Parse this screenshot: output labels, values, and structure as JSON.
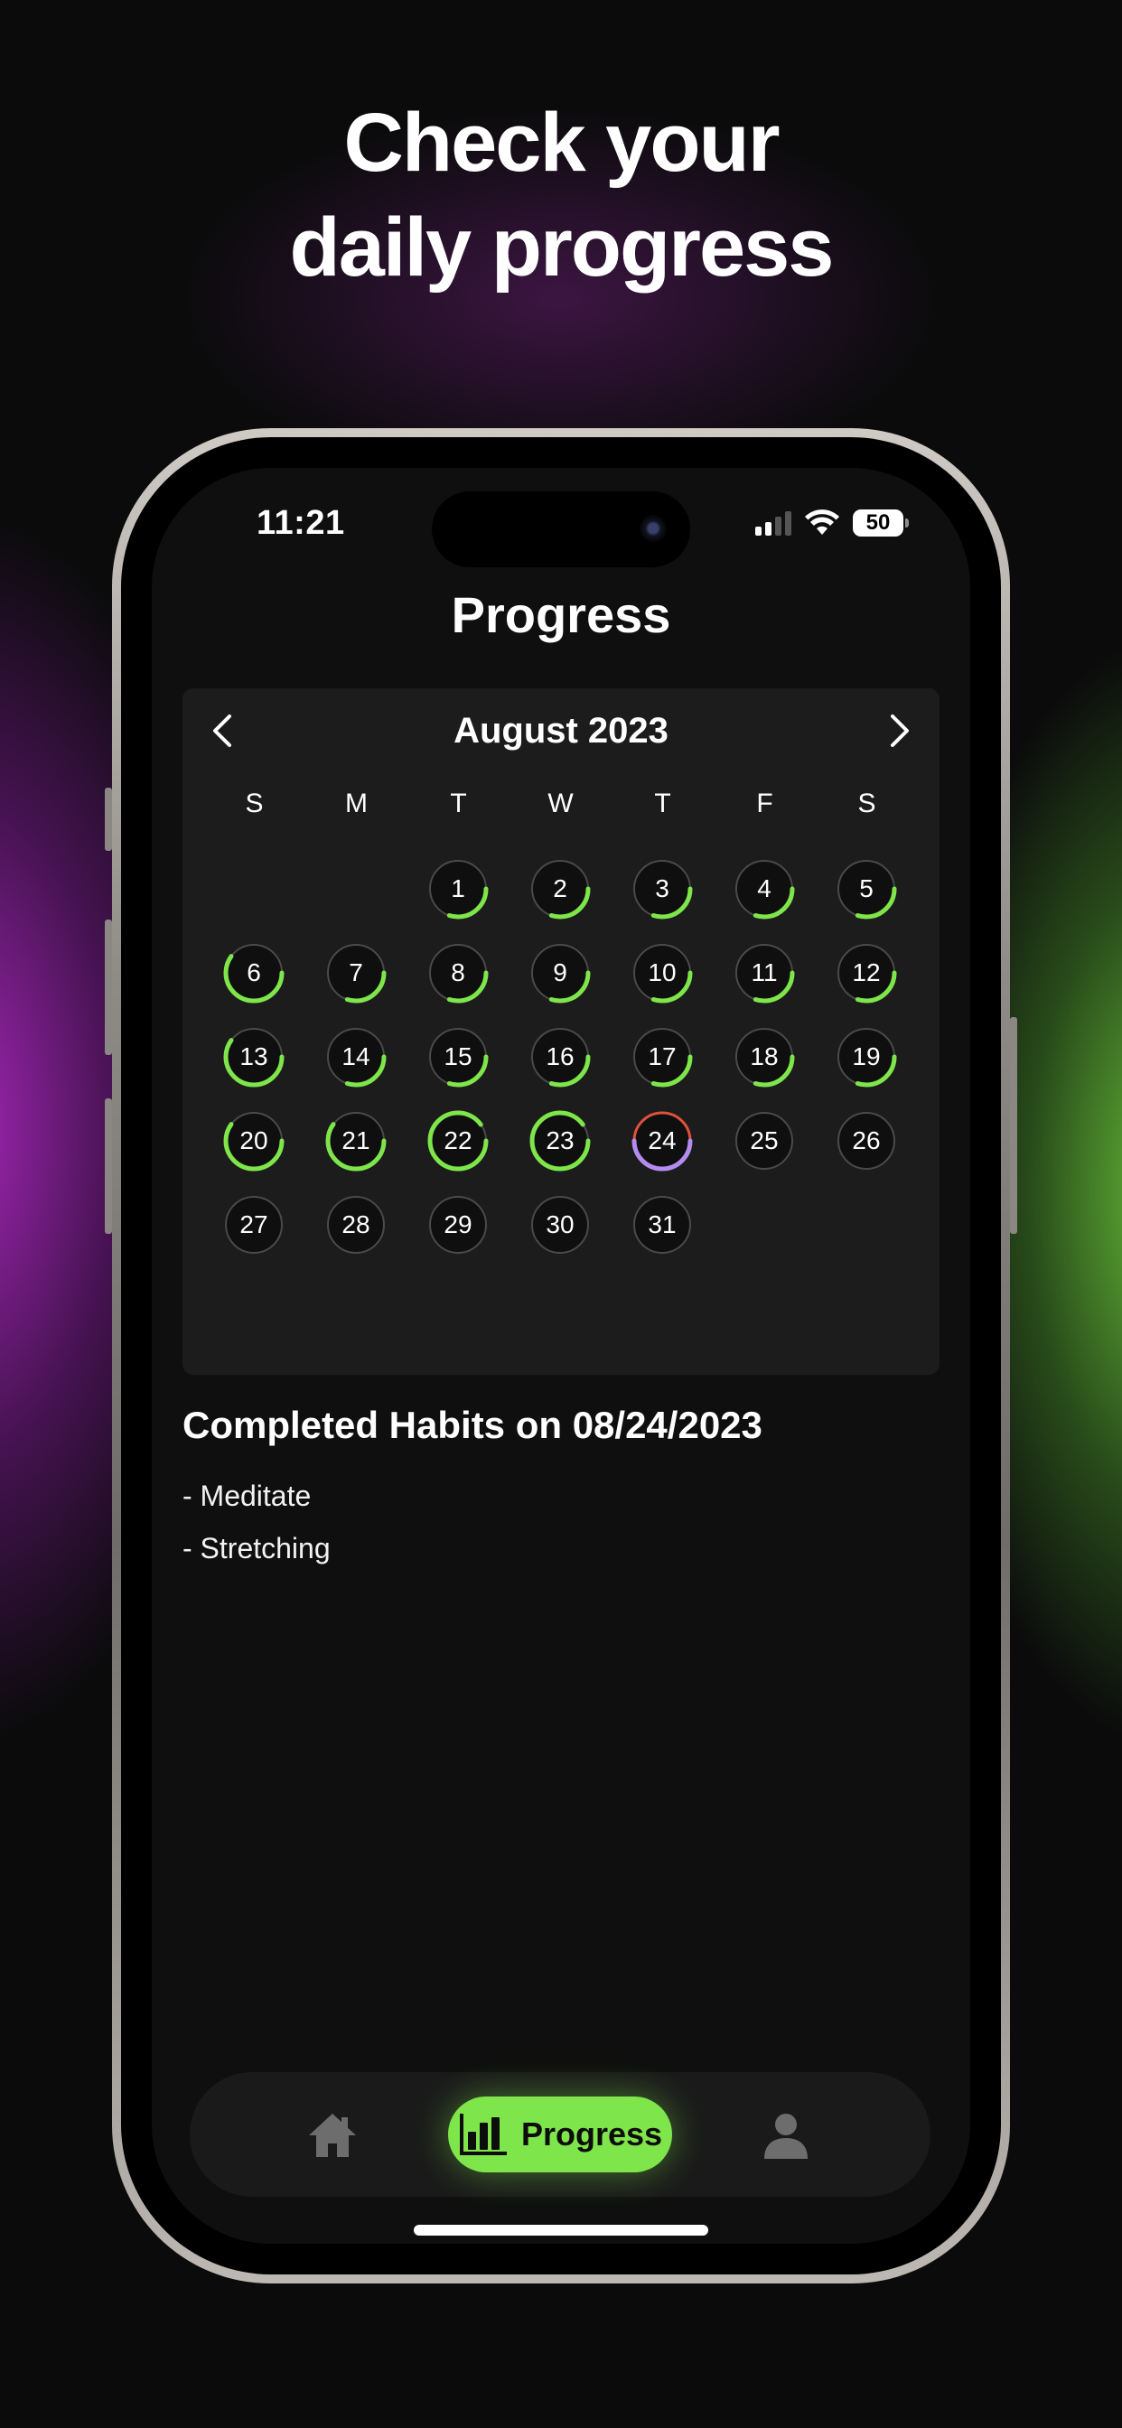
{
  "headline": {
    "line1": "Check your",
    "line2": "daily progress"
  },
  "status_bar": {
    "time": "11:21",
    "battery": "50"
  },
  "page_title": "Progress",
  "calendar": {
    "month_label": "August 2023",
    "prev_icon": "chevron-left-icon",
    "next_icon": "chevron-right-icon",
    "weekdays": [
      "S",
      "M",
      "T",
      "W",
      "T",
      "F",
      "S"
    ],
    "first_weekday_index": 2,
    "days": [
      {
        "day": "1",
        "progress": 0.3,
        "color": "#7ee54a"
      },
      {
        "day": "2",
        "progress": 0.3,
        "color": "#7ee54a"
      },
      {
        "day": "3",
        "progress": 0.3,
        "color": "#7ee54a"
      },
      {
        "day": "4",
        "progress": 0.3,
        "color": "#7ee54a"
      },
      {
        "day": "5",
        "progress": 0.3,
        "color": "#7ee54a"
      },
      {
        "day": "6",
        "progress": 0.6,
        "color": "#7ee54a"
      },
      {
        "day": "7",
        "progress": 0.3,
        "color": "#7ee54a"
      },
      {
        "day": "8",
        "progress": 0.3,
        "color": "#7ee54a"
      },
      {
        "day": "9",
        "progress": 0.3,
        "color": "#7ee54a"
      },
      {
        "day": "10",
        "progress": 0.3,
        "color": "#7ee54a"
      },
      {
        "day": "11",
        "progress": 0.3,
        "color": "#7ee54a"
      },
      {
        "day": "12",
        "progress": 0.3,
        "color": "#7ee54a"
      },
      {
        "day": "13",
        "progress": 0.6,
        "color": "#7ee54a"
      },
      {
        "day": "14",
        "progress": 0.3,
        "color": "#7ee54a"
      },
      {
        "day": "15",
        "progress": 0.3,
        "color": "#7ee54a"
      },
      {
        "day": "16",
        "progress": 0.3,
        "color": "#7ee54a"
      },
      {
        "day": "17",
        "progress": 0.3,
        "color": "#7ee54a"
      },
      {
        "day": "18",
        "progress": 0.3,
        "color": "#7ee54a"
      },
      {
        "day": "19",
        "progress": 0.3,
        "color": "#7ee54a"
      },
      {
        "day": "20",
        "progress": 0.6,
        "color": "#7ee54a"
      },
      {
        "day": "21",
        "progress": 0.6,
        "color": "#7ee54a"
      },
      {
        "day": "22",
        "progress": 0.9,
        "color": "#7ee54a"
      },
      {
        "day": "23",
        "progress": 0.9,
        "color": "#7ee54a"
      },
      {
        "day": "24",
        "progress": 0.5,
        "color": "#b48cf0",
        "today": true,
        "today_color": "#e0513a"
      },
      {
        "day": "25",
        "progress": 0,
        "color": "#7ee54a"
      },
      {
        "day": "26",
        "progress": 0,
        "color": "#7ee54a"
      },
      {
        "day": "27",
        "progress": 0,
        "color": "#7ee54a"
      },
      {
        "day": "28",
        "progress": 0,
        "color": "#7ee54a"
      },
      {
        "day": "29",
        "progress": 0,
        "color": "#7ee54a"
      },
      {
        "day": "30",
        "progress": 0,
        "color": "#7ee54a"
      },
      {
        "day": "31",
        "progress": 0,
        "color": "#7ee54a"
      }
    ]
  },
  "completed": {
    "title": "Completed Habits on 08/24/2023",
    "habits": [
      "- Meditate",
      "- Stretching"
    ]
  },
  "tab_bar": {
    "home_icon": "home-icon",
    "progress_icon": "bar-chart-icon",
    "progress_label": "Progress",
    "profile_icon": "profile-icon",
    "active_color": "#7ee54a"
  }
}
